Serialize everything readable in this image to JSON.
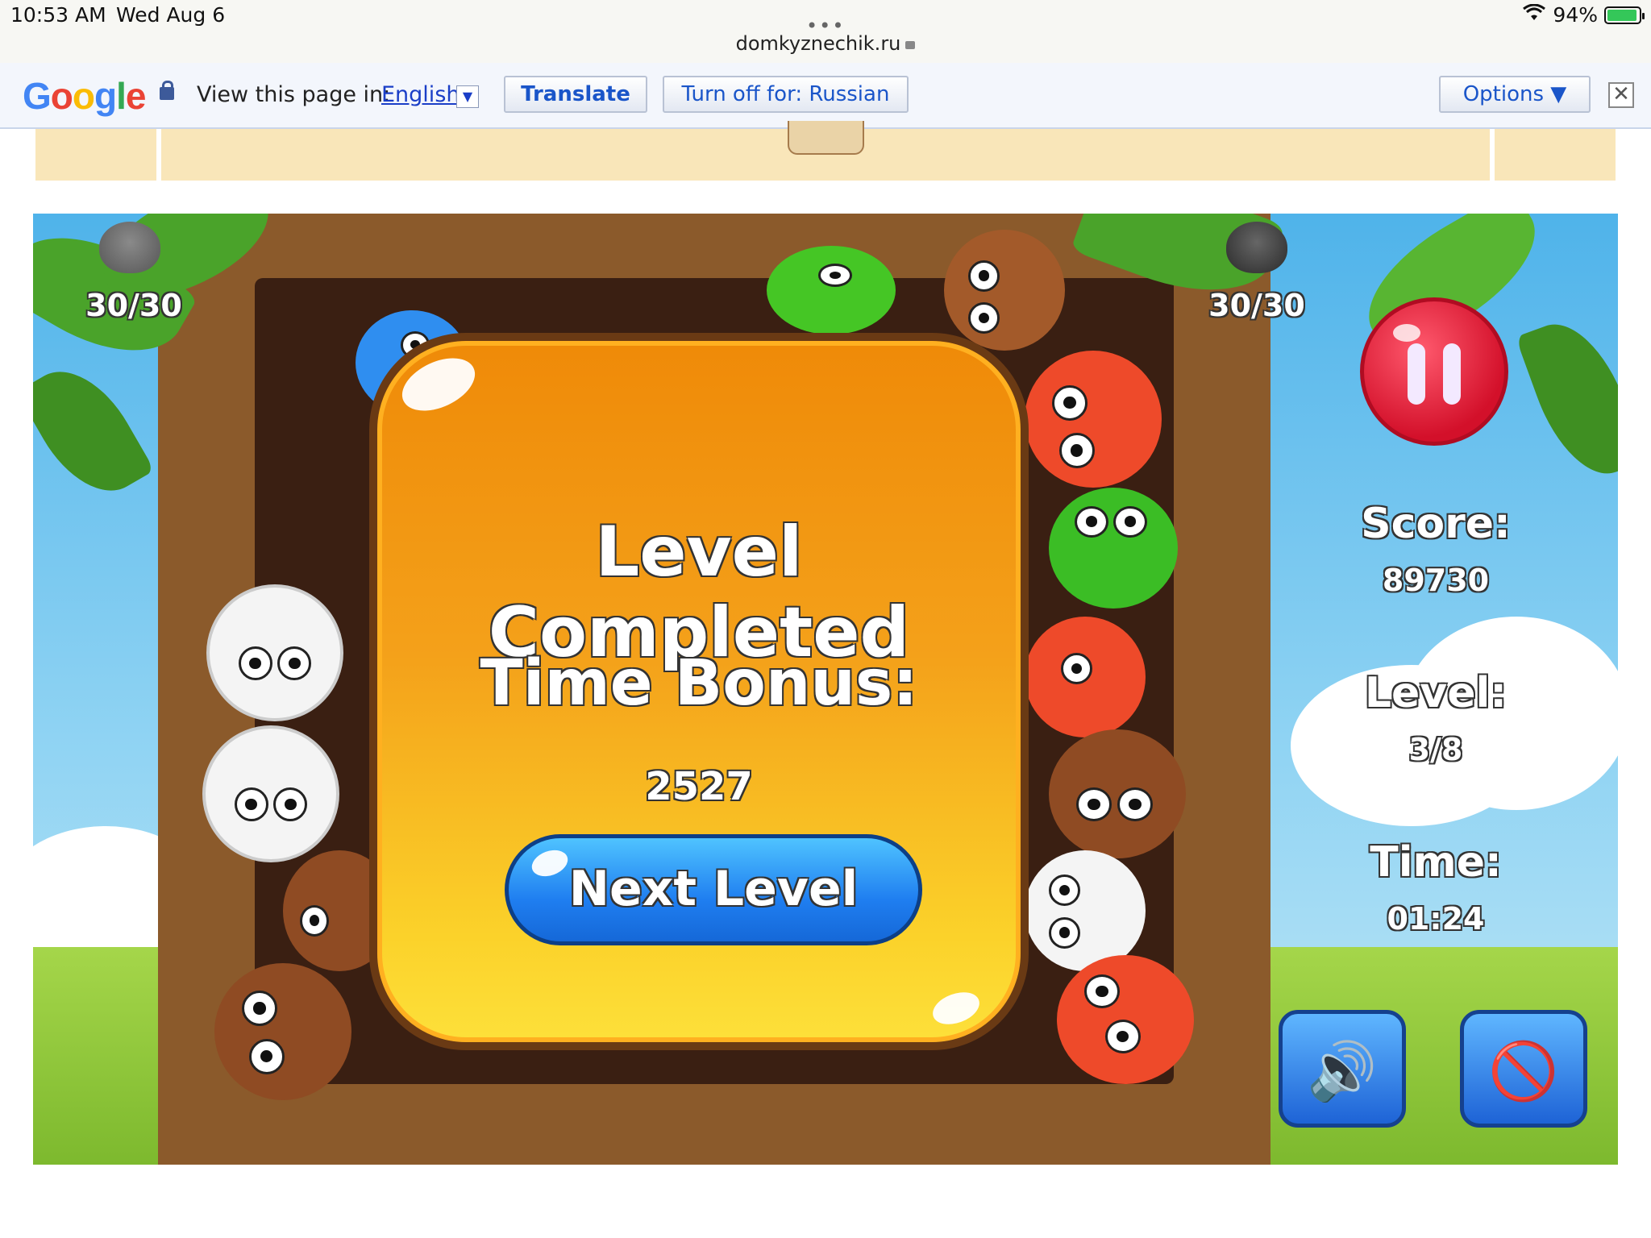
{
  "status_bar": {
    "time": "10:53 AM",
    "date": "Wed Aug 6",
    "url": "domkyznechik.ru",
    "battery": "94%",
    "battery_level": 0.94
  },
  "translate_bar": {
    "logo": "Google",
    "prompt": "View this page in:",
    "language": "English",
    "translate_button": "Translate",
    "turn_off_button": "Turn off for: Russian",
    "options_button": "Options ▼",
    "close_icon": "close-icon"
  },
  "game": {
    "left_counter": "30/30",
    "right_counter": "30/30",
    "score_label": "Score:",
    "score_value": "89730",
    "level_label": "Level:",
    "level_value": "3/8",
    "time_label": "Time:",
    "time_value": "01:24",
    "sound_icon": "speaker-icon",
    "music_icon": "music-off-icon",
    "pause_icon": "pause-icon"
  },
  "modal": {
    "title": "Level Completed",
    "bonus_label": "Time Bonus:",
    "bonus_value": "2527",
    "next_button": "Next Level"
  },
  "colors": {
    "modal_top": "#ef8a08",
    "modal_bottom": "#fde03a",
    "next_button": "#1f7ef0",
    "pause_button": "#d3102a",
    "frame": "#8b5a2b"
  }
}
